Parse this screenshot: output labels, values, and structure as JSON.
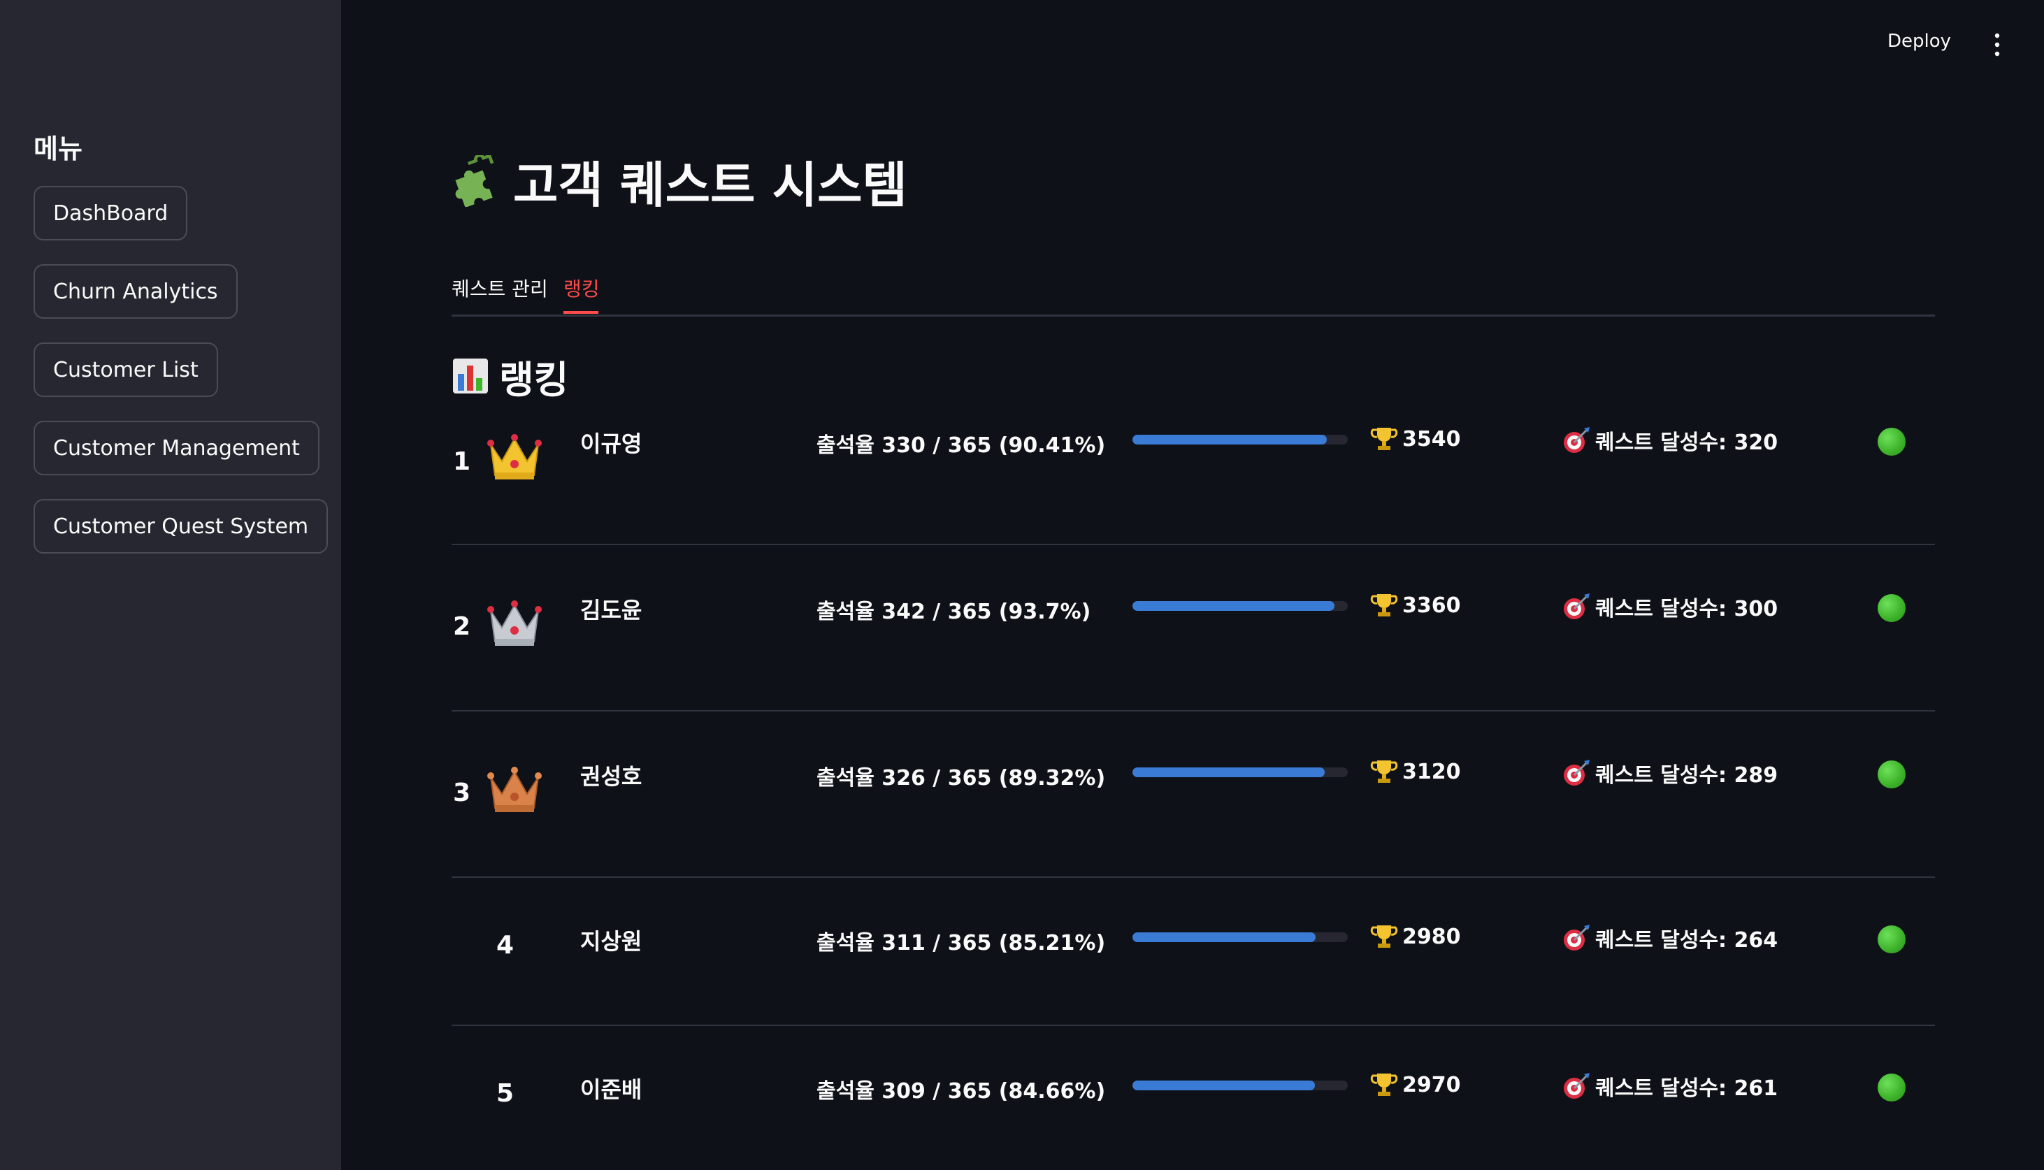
{
  "sidebar": {
    "title": "메뉴",
    "items": [
      {
        "label": "DashBoard"
      },
      {
        "label": "Churn Analytics"
      },
      {
        "label": "Customer List"
      },
      {
        "label": "Customer Management"
      },
      {
        "label": "Customer Quest System"
      }
    ]
  },
  "header": {
    "deploy_label": "Deploy",
    "menu_icon": "vertical-dots-icon"
  },
  "main": {
    "title": "고객 퀘스트 시스템",
    "title_icon": "puzzle-icon",
    "tabs": [
      {
        "label": "퀘스트 관리",
        "active": false
      },
      {
        "label": "랭킹",
        "active": true
      }
    ],
    "section_title": "랭킹",
    "section_icon": "bar-chart-icon"
  },
  "ranking": [
    {
      "rank": "1",
      "crown": "gold-crown-icon",
      "name": "이규영",
      "attendance": "출석율 330 / 365 (90.41%)",
      "progress": 0.9041,
      "points": "3540",
      "quests": "퀘스트 달성수: 320",
      "status": "green"
    },
    {
      "rank": "2",
      "crown": "silver-crown-icon",
      "name": "김도윤",
      "attendance": "출석율 342 / 365 (93.7%)",
      "progress": 0.937,
      "points": "3360",
      "quests": "퀘스트 달성수: 300",
      "status": "green"
    },
    {
      "rank": "3",
      "crown": "bronze-crown-icon",
      "name": "권성호",
      "attendance": "출석율 326 / 365 (89.32%)",
      "progress": 0.8932,
      "points": "3120",
      "quests": "퀘스트 달성수: 289",
      "status": "green"
    },
    {
      "rank": "4",
      "crown": null,
      "name": "지상원",
      "attendance": "출석율 311 / 365 (85.21%)",
      "progress": 0.8521,
      "points": "2980",
      "quests": "퀘스트 달성수: 264",
      "status": "green"
    },
    {
      "rank": "5",
      "crown": null,
      "name": "이준배",
      "attendance": "출석율 309 / 365 (84.66%)",
      "progress": 0.8466,
      "points": "2970",
      "quests": "퀘스트 달성수: 261",
      "status": "green"
    }
  ],
  "colors": {
    "background": "#0e1117",
    "sidebar": "#262730",
    "accent": "#ff4b4b",
    "progress": "#3a7bd5",
    "status_green": "#3fb52c"
  }
}
